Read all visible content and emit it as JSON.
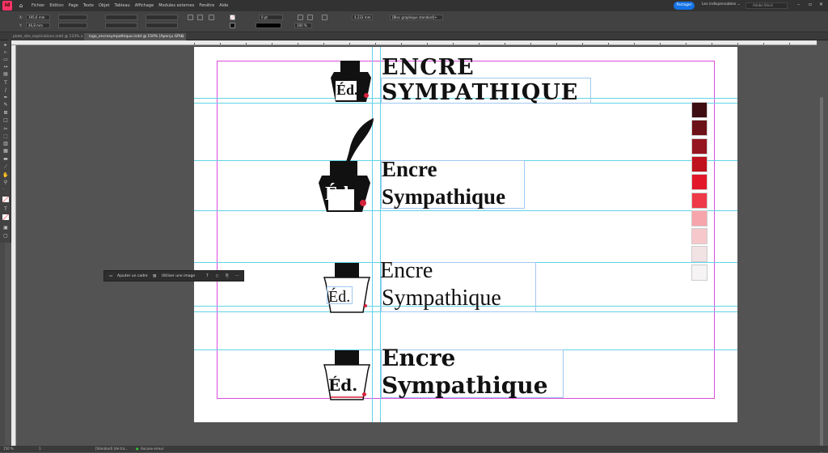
{
  "app": {
    "logo_text": "Id",
    "home_icon": "home-icon"
  },
  "menu": [
    "Fichier",
    "Edition",
    "Page",
    "Texte",
    "Objet",
    "Tableau",
    "Affichage",
    "Modules externes",
    "Fenêtre",
    "Aide"
  ],
  "topright": {
    "share": "Partager",
    "workspace": "Les indispensables",
    "search_placeholder": "Adobe Stock"
  },
  "control": {
    "x": "195,6 mm",
    "y": "46,8 mm",
    "stroke": "0 pt",
    "zoom": "100 %",
    "dimension": "4,233 mm",
    "object_style": "[Bloc graphique standard]+"
  },
  "tabs": [
    {
      "label": "plate_site_explications.indd @ 133%"
    },
    {
      "label": "logo_encresympathique.indd @ 150% [Aperçu GPU]"
    }
  ],
  "logos": [
    {
      "line1": "ENCRE",
      "line2": "SYMPATHIQUE",
      "mark": "Éd."
    },
    {
      "line1": "Encre",
      "line2": "Sympathique",
      "mark": "Éd."
    },
    {
      "line1": "Encre",
      "line2": "Sympathique",
      "mark": "Éd."
    },
    {
      "line1": "Encre",
      "line2": "Sympathique",
      "mark": "Éd."
    }
  ],
  "swatches": [
    "#3d0d12",
    "#6d1118",
    "#951521",
    "#c0111e",
    "#e3172a",
    "#ee3948",
    "#f7a5ac",
    "#f7c8cb",
    "#f1e2e3",
    "#f5f3f3"
  ],
  "context_menu": {
    "add_frame": "Ajouter un cadre",
    "use_image": "Utiliser une image"
  },
  "status": {
    "zoom": "150 %",
    "page": "1",
    "style": "[Standard] (de tra...",
    "preflight": "Aucune erreur"
  },
  "colors": {
    "accent_red": "#d6213c",
    "guide": "#62d3e6",
    "margin": "#d94dd9",
    "share_blue": "#1473e6"
  }
}
